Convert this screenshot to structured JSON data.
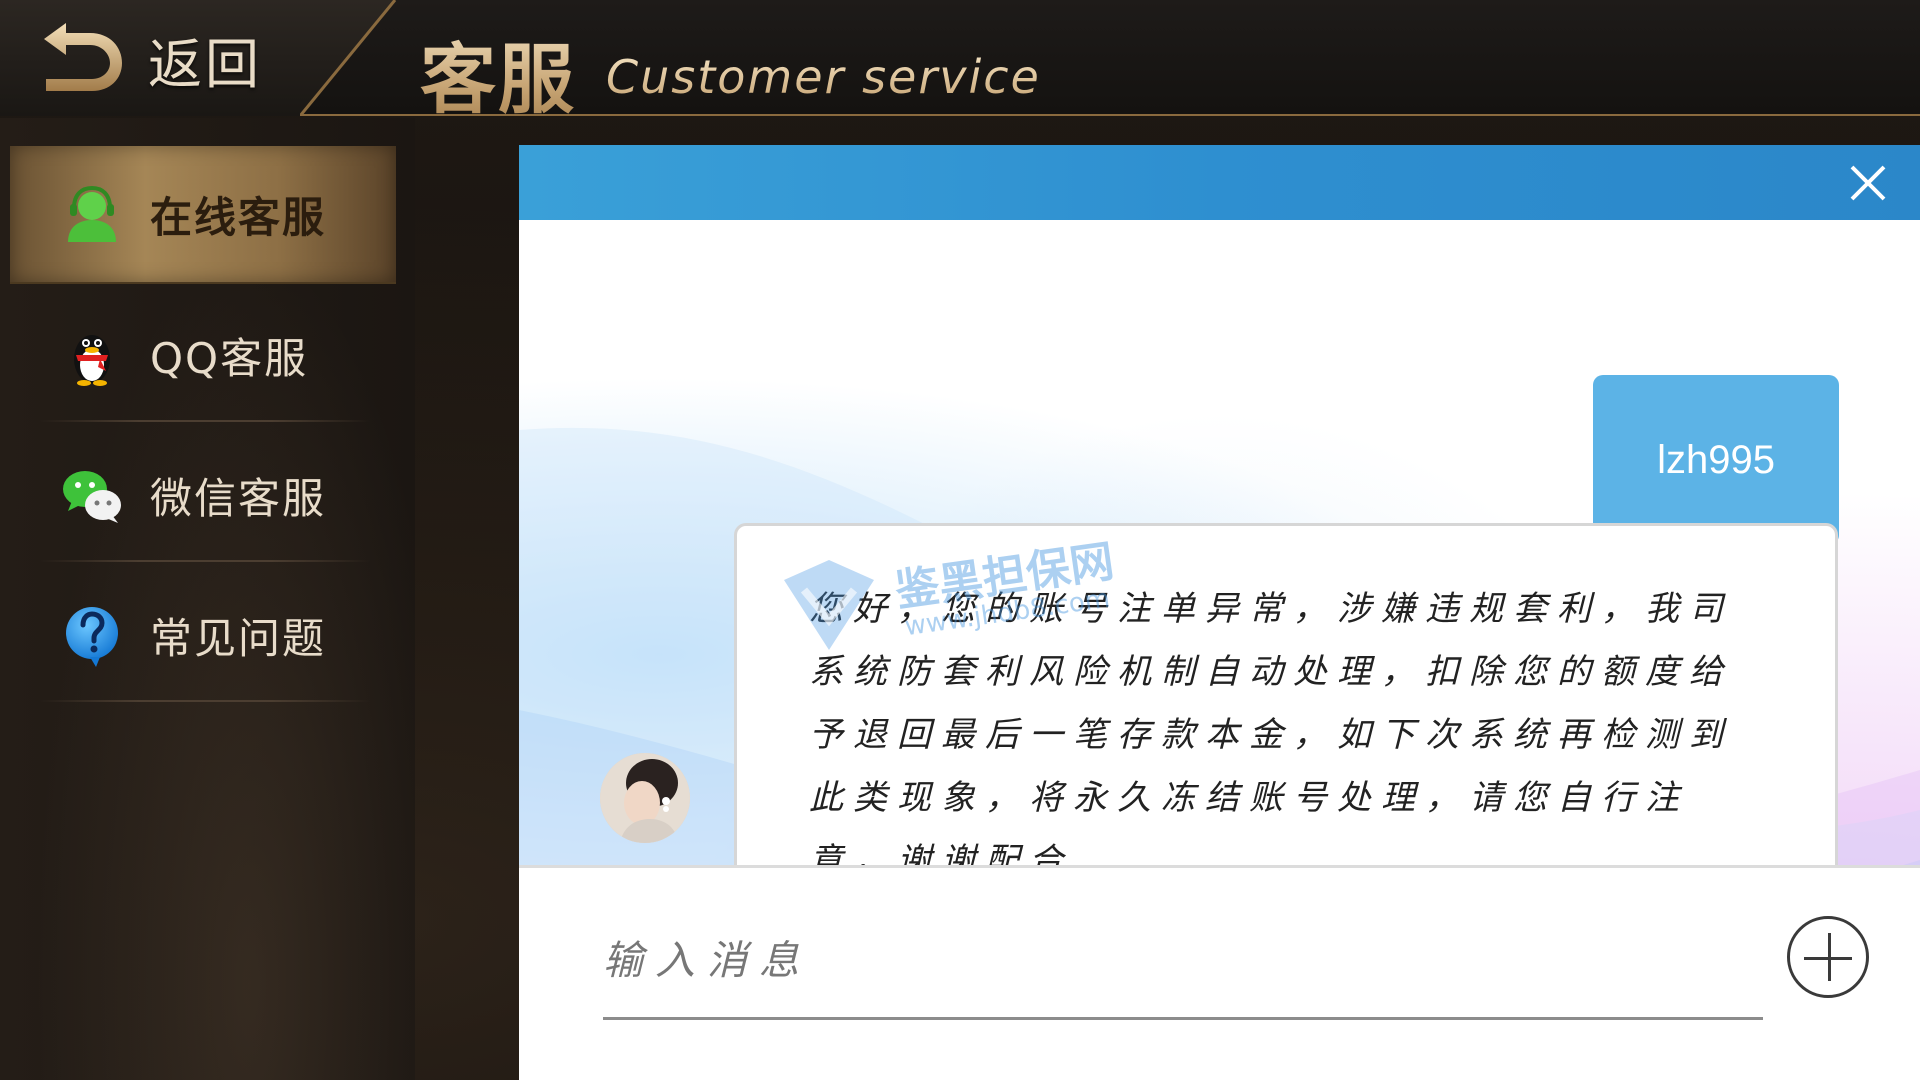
{
  "header": {
    "back_label": "返回",
    "title": "客服",
    "subtitle": "Customer service"
  },
  "sidebar": {
    "items": [
      {
        "label": "在线客服",
        "icon": "headset-user-icon",
        "active": true
      },
      {
        "label": "QQ客服",
        "icon": "qq-penguin-icon",
        "active": false
      },
      {
        "label": "微信客服",
        "icon": "wechat-icon",
        "active": false
      },
      {
        "label": "常见问题",
        "icon": "question-icon",
        "active": false
      }
    ]
  },
  "chat": {
    "messages": [
      {
        "from": "user",
        "text": "lzh995"
      },
      {
        "from": "agent",
        "text": "您好，您的账号注单异常，涉嫌违规套利，我司系统防套利风险机制自动处理，扣除您的额度给予退回最后一笔存款本金，如下次系统再检测到此类现象，将永久冻结账号处理，请您自行注意，谢谢配合"
      }
    ],
    "watermark": {
      "text": "鉴黑担保网",
      "url": "www.jhdb8.com"
    },
    "input": {
      "placeholder": "输入消息",
      "value": ""
    }
  },
  "colors": {
    "topbar": "#2e8fd0",
    "user_bubble": "#5cb3e6",
    "accent_gold": "#c9a777",
    "active_tab": "#a58656"
  }
}
